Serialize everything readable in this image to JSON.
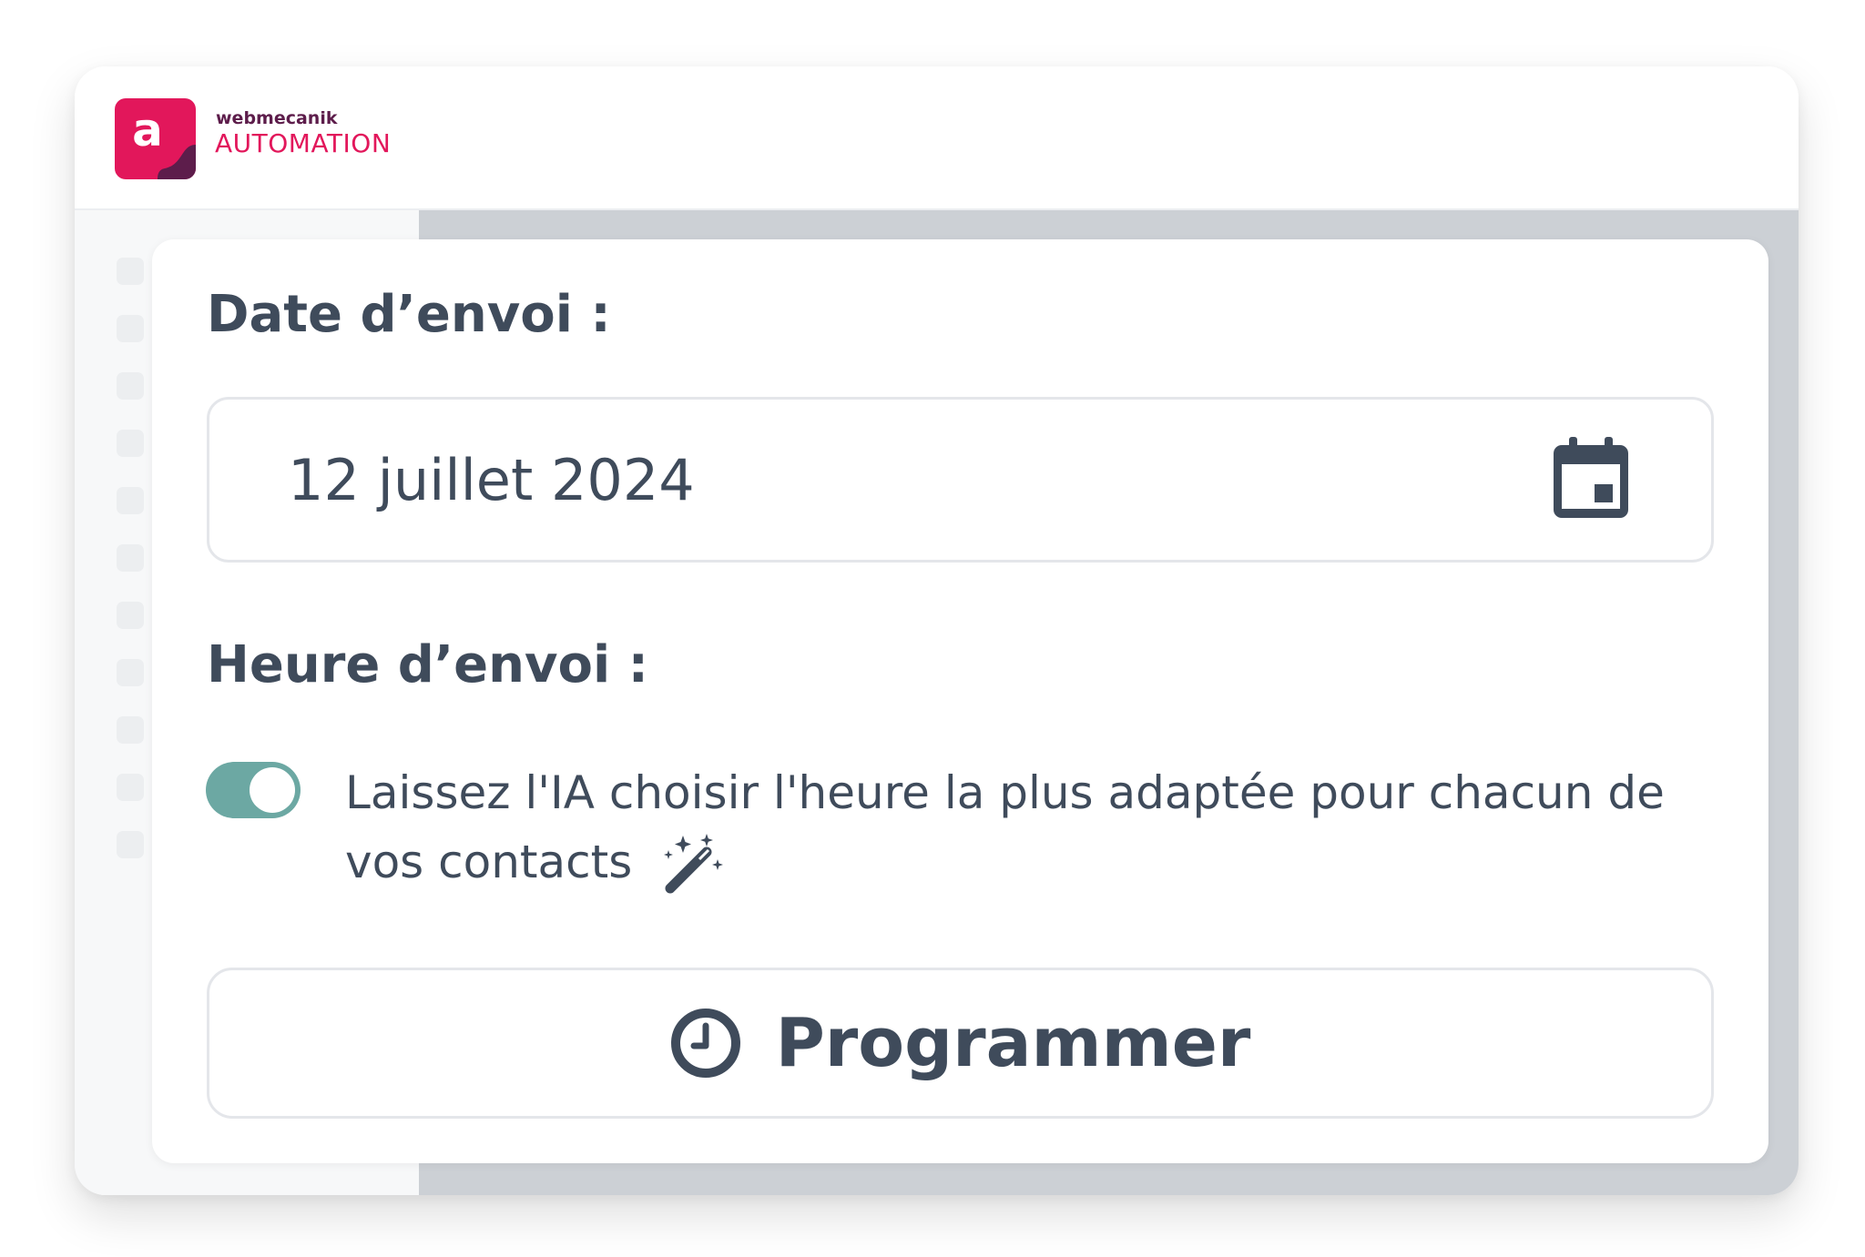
{
  "brand": {
    "logo_letter": "a",
    "name": "webmecanik",
    "product": "AUTOMATION"
  },
  "form": {
    "date_label": "Date d’envoi :",
    "date_value": "12 juillet 2024",
    "time_label": "Heure d’envoi :",
    "ai_toggle_on": true,
    "ai_toggle_text": "Laissez l'IA choisir l'heure la plus adaptée pour chacun de vos contacts",
    "schedule_button_label": "Programmer"
  },
  "icons": {
    "date_field": "calendar-icon",
    "ai_option": "magic-wand-icon",
    "schedule_button": "clock-icon"
  },
  "colors": {
    "brand_pink": "#e2175b",
    "brand_purple": "#5d1d4b",
    "toggle_on": "#6ca8a3",
    "text": "#3f4b5b"
  }
}
